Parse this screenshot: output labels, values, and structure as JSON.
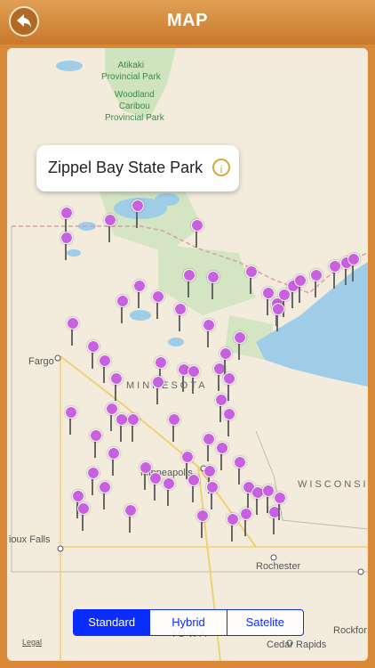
{
  "header": {
    "title": "MAP",
    "back_icon": "back-arrow-icon"
  },
  "callout": {
    "text": "Zippel Bay State Park",
    "icon": "info-icon"
  },
  "places": {
    "atikaki": "Atikaki\nProvincial Park",
    "woodland": "Woodland\nCaribou\nProvincial Park",
    "fargo": "Fargo",
    "minnesota": "MINNESOTA",
    "minneapolis": "Minneapolis",
    "wisconsin": "WISCONSIN",
    "sioux_falls": "ioux Falls",
    "rochester": "Rochester",
    "rockford": "Rockfor",
    "cedar_rapids": "Cedar Rapids",
    "iowa": "IOWA"
  },
  "map_type": {
    "options": [
      "Standard",
      "Hybrid",
      "Satelite"
    ],
    "selected": "Standard"
  },
  "legal": "Legal",
  "colors": {
    "header": "#d08533",
    "accent": "#0a2cff",
    "pin": "#c860e0"
  }
}
